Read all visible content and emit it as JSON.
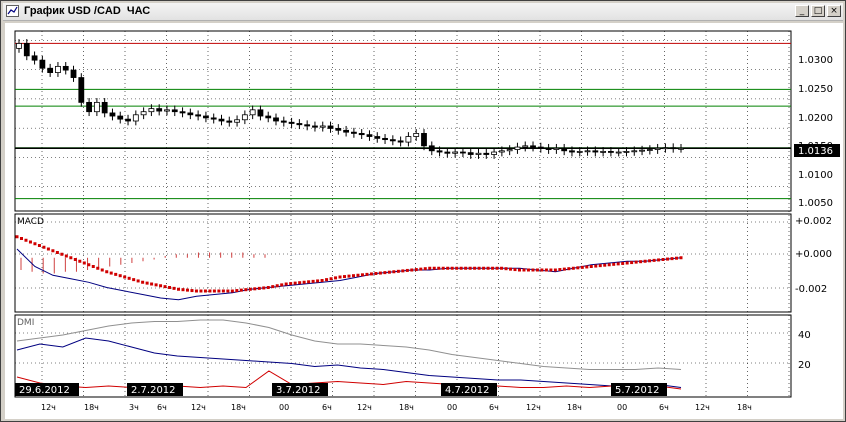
{
  "window": {
    "title": "График USD /CAD  ЧАС",
    "minimize_glyph": "_",
    "maximize_glyph": "□",
    "close_glyph": "×"
  },
  "colors": {
    "up_candle": "#ffffff",
    "down_candle": "#000000",
    "resistance_line": "#c00000",
    "support_line": "#008000",
    "current_price_line": "#000000",
    "macd_histogram": "#d04040",
    "macd_signal": "#d00000",
    "macd_line": "#000080",
    "dmi_adx": "#909090",
    "dmi_plus": "#000080",
    "dmi_minus": "#d00000",
    "grid": "#000000"
  },
  "price_panel": {
    "y_ticks": [
      "1.0300",
      "1.0250",
      "1.0200",
      "1.0150",
      "1.0100",
      "1.0050"
    ],
    "current_price_label": "1.0136",
    "resistance_level": 1.0305,
    "support_levels": [
      1.0231,
      1.0204,
      1.0137,
      1.0055
    ],
    "current_price": 1.0136
  },
  "macd_panel": {
    "label": "MACD",
    "y_ticks": [
      "+0.002",
      "+0.000",
      "-0.002"
    ]
  },
  "dmi_panel": {
    "label": "DMI",
    "y_ticks": [
      "40",
      "20"
    ]
  },
  "time_axis": {
    "date_labels": [
      "29.6.2012",
      "2.7.2012",
      "3.7.2012",
      "4.7.2012",
      "5.7.2012"
    ],
    "hour_labels": [
      "12ч",
      "18ч",
      "3ч",
      "6ч",
      "12ч",
      "18ч",
      "00",
      "6ч",
      "12ч",
      "18ч",
      "00",
      "6ч",
      "12ч",
      "18ч",
      "00",
      "6ч",
      "12ч",
      "18ч"
    ]
  },
  "chart_data": {
    "type": "candlestick",
    "symbol": "USD/CAD",
    "timeframe": "1 hour",
    "ylim": [
      1.0035,
      1.0325
    ],
    "closes": [
      1.0305,
      1.0285,
      1.0278,
      1.0265,
      1.0258,
      1.0268,
      1.0262,
      1.025,
      1.021,
      1.0195,
      1.021,
      1.0193,
      1.0188,
      1.0183,
      1.018,
      1.019,
      1.0195,
      1.02,
      1.0196,
      1.0198,
      1.0195,
      1.0193,
      1.019,
      1.0188,
      1.0185,
      1.0183,
      1.018,
      1.0178,
      1.0182,
      1.019,
      1.0198,
      1.0188,
      1.0185,
      1.018,
      1.0178,
      1.0176,
      1.0174,
      1.0172,
      1.017,
      1.0172,
      1.0168,
      1.0165,
      1.0162,
      1.016,
      1.0158,
      1.0155,
      1.0152,
      1.015,
      1.0148,
      1.0146,
      1.0155,
      1.016,
      1.014,
      1.0132,
      1.013,
      1.0128,
      1.013,
      1.0129,
      1.0126,
      1.0128,
      1.0126,
      1.013,
      1.0132,
      1.0134,
      1.0138,
      1.014,
      1.0138,
      1.0136,
      1.0134,
      1.0136,
      1.0132,
      1.013,
      1.0131,
      1.0132,
      1.013,
      1.0131,
      1.013,
      1.013,
      1.0131,
      1.0132,
      1.0133,
      1.0134,
      1.0136,
      1.0137,
      1.0136,
      1.0136
    ],
    "macd_ylim": [
      -0.0031,
      0.0025
    ],
    "macd": [
      0.0005,
      -0.0005,
      -0.001,
      -0.0012,
      -0.0014,
      -0.0017,
      -0.0019,
      -0.0021,
      -0.0023,
      -0.0024,
      -0.0022,
      -0.0021,
      -0.002,
      -0.0018,
      -0.0017,
      -0.0016,
      -0.0015,
      -0.0014,
      -0.0013,
      -0.0011,
      -0.0009,
      -0.0008,
      -0.0007,
      -0.0007,
      -0.0006,
      -0.0006,
      -0.0006,
      -0.0006,
      -0.0006,
      -0.0007,
      -0.0008,
      -0.0006,
      -0.0004,
      -0.0003,
      -0.0002,
      -0.0002,
      -0.0001,
      0.0
    ],
    "macd_signal": [
      0.0012,
      0.0008,
      0.0004,
      0.0,
      -0.0004,
      -0.0008,
      -0.0011,
      -0.0014,
      -0.0016,
      -0.0018,
      -0.0019,
      -0.0019,
      -0.0019,
      -0.0018,
      -0.0017,
      -0.0015,
      -0.0014,
      -0.0013,
      -0.0011,
      -0.001,
      -0.0009,
      -0.0008,
      -0.0007,
      -0.0006,
      -0.0006,
      -0.0006,
      -0.0006,
      -0.0006,
      -0.0007,
      -0.0007,
      -0.0007,
      -0.0006,
      -0.0005,
      -0.0004,
      -0.0003,
      -0.0002,
      -0.0001,
      0.0
    ],
    "macd_hist": [
      -0.0007,
      -0.0008,
      -0.0009,
      -0.0009,
      -0.0008,
      -0.0008,
      -0.0007,
      -0.0006,
      -0.0005,
      -0.0004,
      -0.0003,
      -0.0002,
      -0.0001,
      0.0001,
      0.0002,
      0.0002,
      0.0003,
      0.0003,
      0.0003,
      0.0003,
      0.0003,
      0.0002,
      0.0002
    ],
    "dmi_ylim": [
      0,
      52
    ],
    "adx": [
      36,
      38,
      40,
      43,
      46,
      48,
      49,
      49,
      50,
      50,
      48,
      45,
      40,
      36,
      34,
      34,
      33,
      32,
      30,
      27,
      25,
      23,
      21,
      19,
      18,
      17,
      17,
      17,
      18,
      17
    ],
    "di_plus": [
      30,
      34,
      32,
      38,
      36,
      32,
      28,
      26,
      25,
      24,
      23,
      22,
      21,
      19,
      20,
      18,
      17,
      15,
      13,
      12,
      11,
      10,
      10,
      9,
      8,
      7,
      6,
      7,
      7,
      5
    ],
    "di_minus": [
      12,
      8,
      6,
      5,
      6,
      5,
      6,
      6,
      5,
      6,
      5,
      16,
      7,
      8,
      9,
      8,
      7,
      9,
      8,
      7,
      6,
      6,
      5,
      5,
      6,
      5,
      6,
      7,
      6,
      4
    ]
  }
}
